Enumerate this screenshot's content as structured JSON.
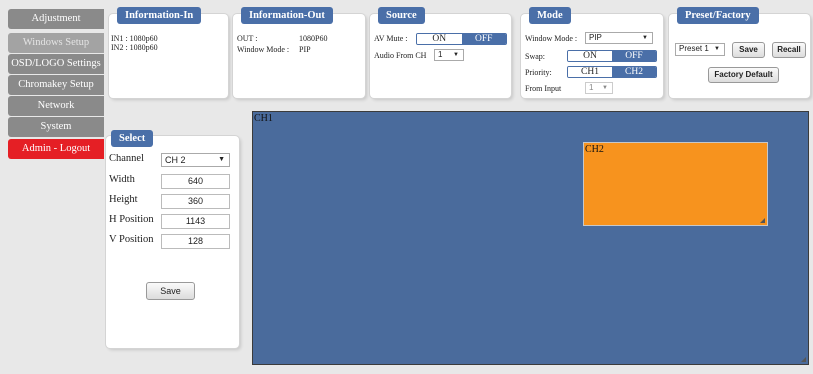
{
  "sidebar": {
    "items": [
      {
        "label": "Adjustment"
      },
      {
        "label": "Windows Setup"
      },
      {
        "label": "OSD/LOGO Settings"
      },
      {
        "label": "Chromakey Setup"
      },
      {
        "label": "Network"
      },
      {
        "label": "System"
      },
      {
        "label": "Admin - Logout"
      }
    ]
  },
  "info_in": {
    "title": "Information-In",
    "in1": "IN1 : 1080p60",
    "in2": "IN2 : 1080p60"
  },
  "info_out": {
    "title": "Information-Out",
    "out_label": "OUT :",
    "out_value": "1080P60",
    "mode_label": "Window Mode :",
    "mode_value": "PIP"
  },
  "source": {
    "title": "Source",
    "av_mute_label": "AV Mute :",
    "on": "ON",
    "off": "OFF",
    "audio_label": "Audio From CH",
    "audio_value": "1"
  },
  "mode": {
    "title": "Mode",
    "window_mode_label": "Window Mode :",
    "window_mode_value": "PIP",
    "swap_label": "Swap:",
    "swap_on": "ON",
    "swap_off": "OFF",
    "priority_label": "Priority:",
    "ch1": "CH1",
    "ch2": "CH2",
    "from_input_label": "From Input",
    "from_input_value": "1"
  },
  "preset": {
    "title": "Preset/Factory",
    "preset_value": "Preset 1",
    "save": "Save",
    "recall": "Recall",
    "factory": "Factory Default"
  },
  "select": {
    "title": "Select",
    "channel_label": "Channel",
    "channel_value": "CH 2",
    "width_label": "Width",
    "width_value": "640",
    "height_label": "Height",
    "height_value": "360",
    "hpos_label": "H Position",
    "hpos_value": "1143",
    "vpos_label": "V Position",
    "vpos_value": "128",
    "save": "Save"
  },
  "canvas": {
    "ch1_label": "CH1",
    "ch2_label": "CH2"
  },
  "colors": {
    "accent": "#4a6fa8",
    "canvas": "#4a6b9c",
    "pip": "#f7931e",
    "logout": "#e51f25"
  }
}
